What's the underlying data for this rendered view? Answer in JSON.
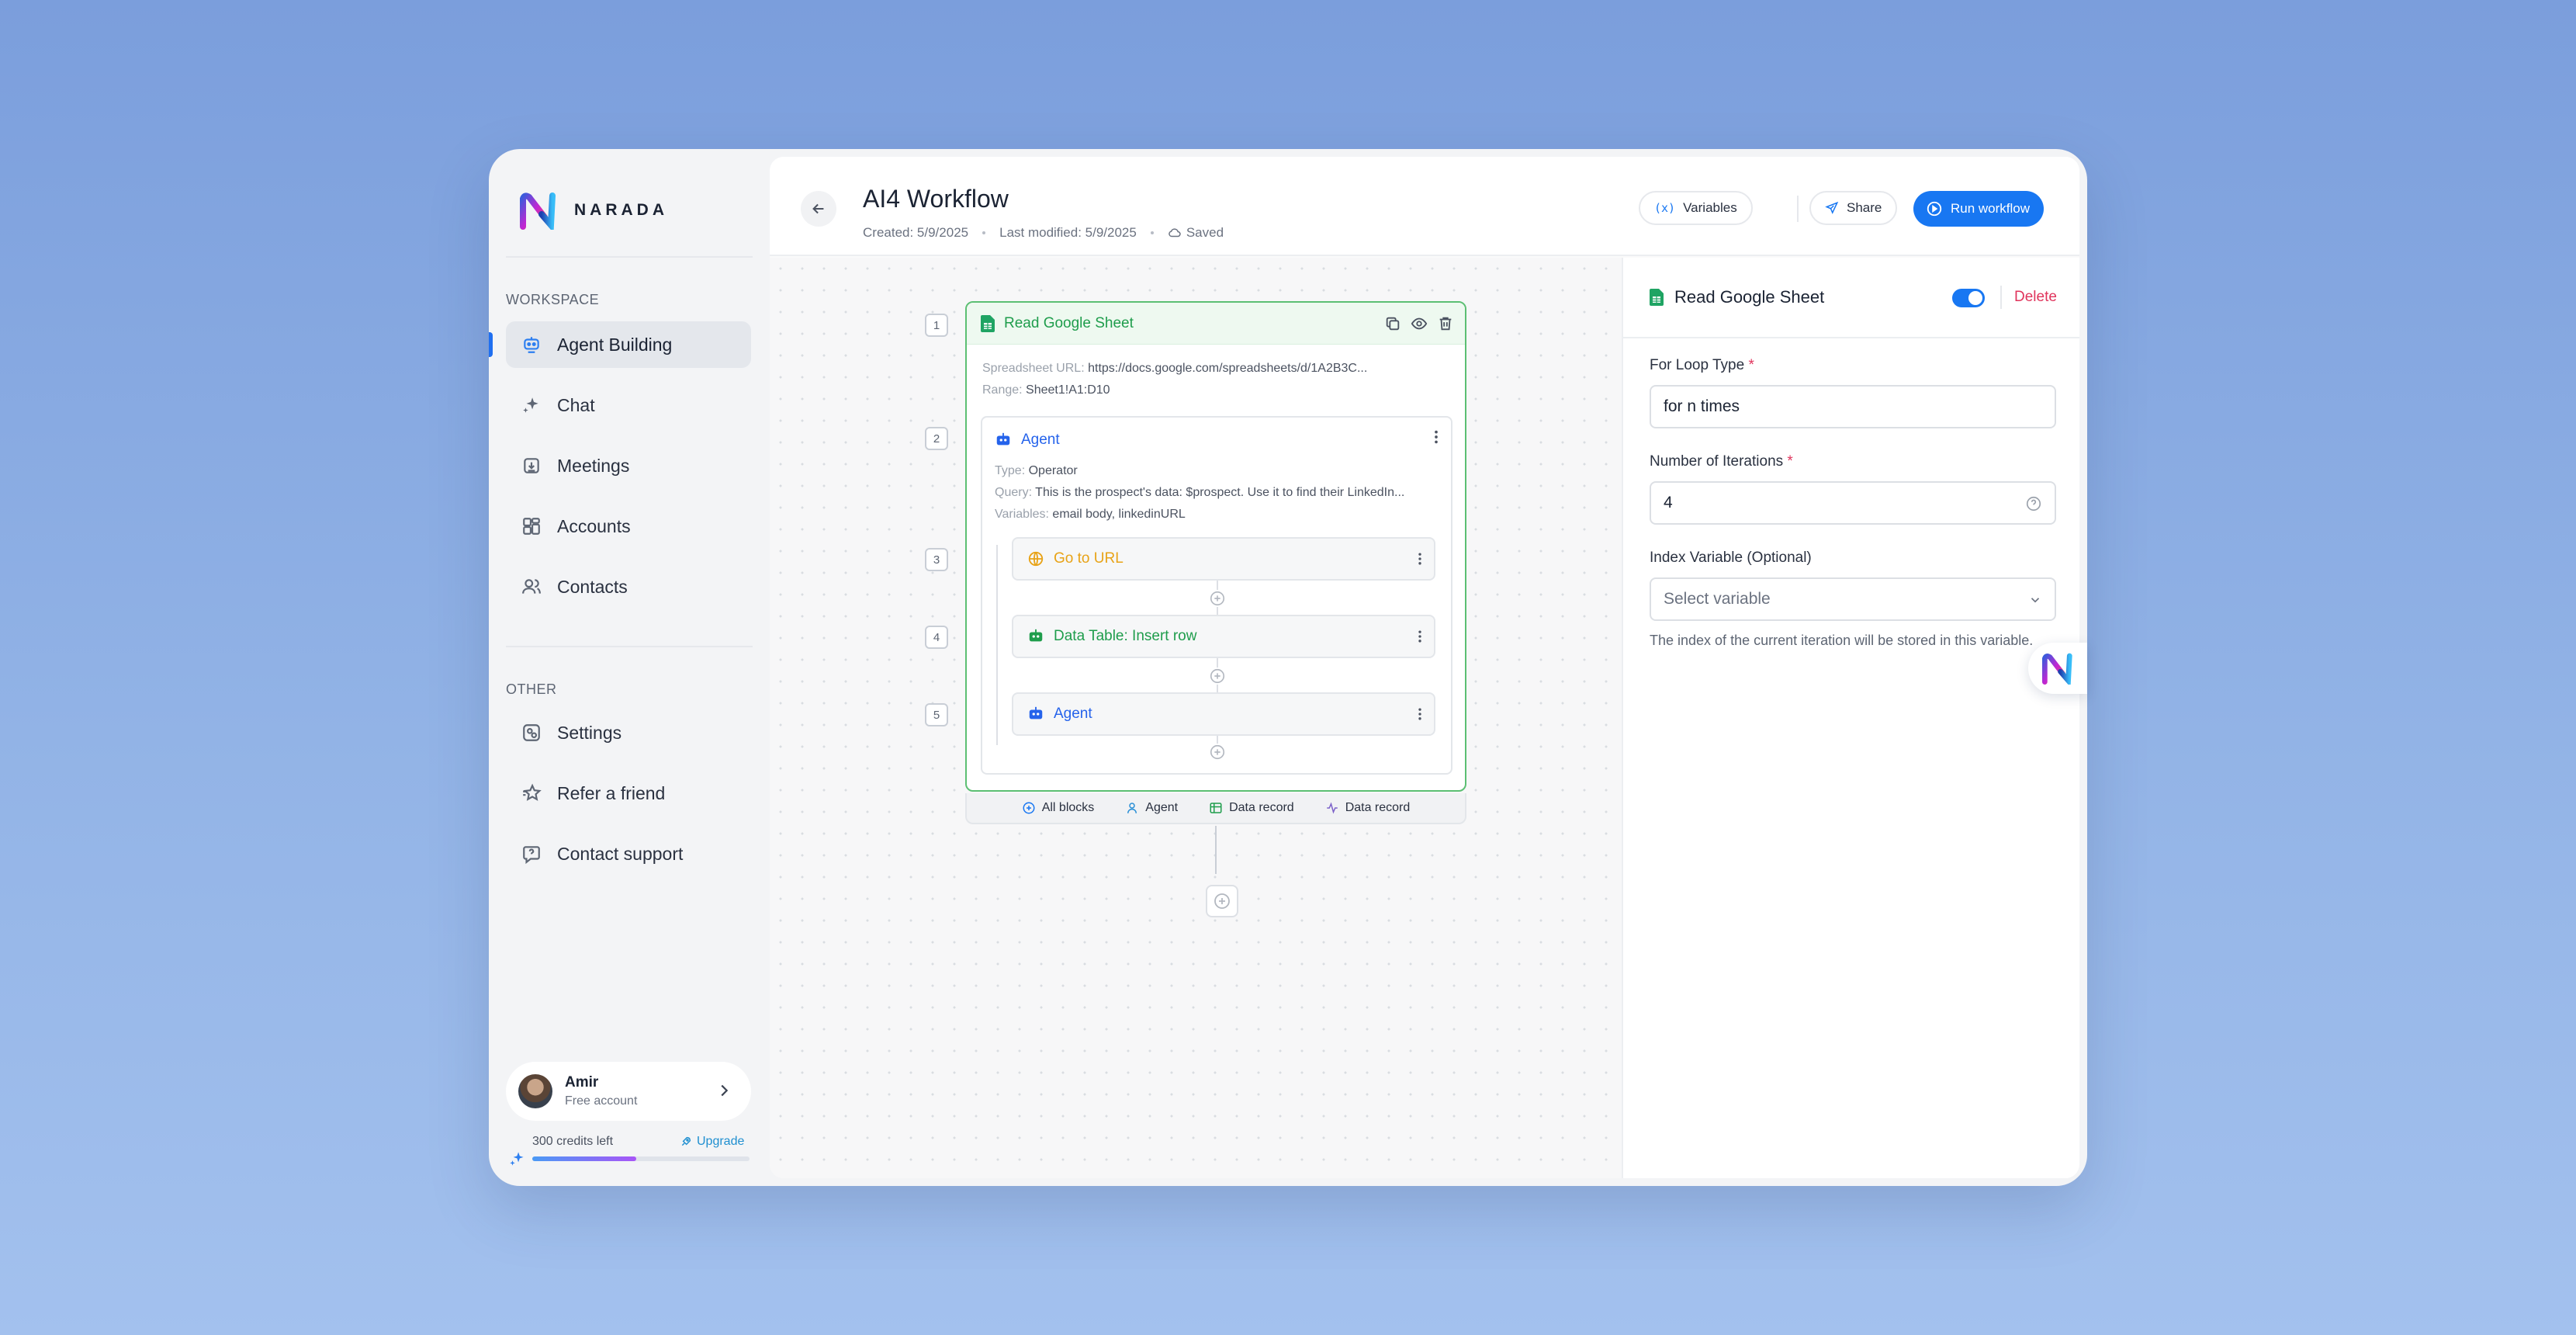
{
  "brand": {
    "name": "NARADA"
  },
  "sidebar": {
    "workspace_label": "WORKSPACE",
    "other_label": "OTHER",
    "items": [
      {
        "label": "Agent Building",
        "icon": "robot-icon",
        "active": true
      },
      {
        "label": "Chat",
        "icon": "sparkle-icon"
      },
      {
        "label": "Meetings",
        "icon": "calendar-download-icon"
      },
      {
        "label": "Accounts",
        "icon": "grid-icon"
      },
      {
        "label": "Contacts",
        "icon": "users-icon"
      }
    ],
    "other_items": [
      {
        "label": "Settings",
        "icon": "settings-icon"
      },
      {
        "label": "Refer a friend",
        "icon": "star-icon"
      },
      {
        "label": "Contact support",
        "icon": "help-bubble-icon"
      }
    ],
    "user": {
      "name": "Amir",
      "plan": "Free account"
    },
    "credits": {
      "text": "300 credits left",
      "upgrade_label": "Upgrade",
      "progress": 0.48
    }
  },
  "header": {
    "title": "AI4 Workflow",
    "created": "Created: 5/9/2025",
    "modified": "Last modified: 5/9/2025",
    "saved": "Saved",
    "variables_label": "Variables",
    "share_label": "Share",
    "run_label": "Run workflow"
  },
  "canvas": {
    "steps": [
      "1",
      "2",
      "3",
      "4",
      "5"
    ],
    "sheet_block": {
      "title": "Read Google Sheet",
      "url_key": "Spreadsheet URL:",
      "url_value": "https://docs.google.com/spreadsheets/d/1A2B3C...",
      "range_key": "Range:",
      "range_value": "Sheet1!A1:D10"
    },
    "agent_block": {
      "title": "Agent",
      "type_key": "Type:",
      "type_value": "Operator",
      "query_key": "Query:",
      "query_value": "This is the prospect's data: $prospect. Use it to find their LinkedIn...",
      "vars_key": "Variables:",
      "vars_value": "email body, linkedinURL"
    },
    "inner_blocks": [
      {
        "title": "Go to URL",
        "icon": "globe-icon",
        "color": "#e8a317"
      },
      {
        "title": "Data Table: Insert row",
        "icon": "robot-icon",
        "color": "#1f9d4c"
      },
      {
        "title": "Agent",
        "icon": "robot-icon",
        "color": "#2563eb"
      }
    ],
    "tray": [
      {
        "label": "All blocks",
        "icon": "plus-circle-icon"
      },
      {
        "label": "Agent",
        "icon": "robot-icon"
      },
      {
        "label": "Data record",
        "icon": "table-icon"
      },
      {
        "label": "Data record",
        "icon": "activity-icon"
      }
    ]
  },
  "panel": {
    "title": "Read Google Sheet",
    "toggle_on": true,
    "delete_label": "Delete",
    "loop_type_label": "For Loop Type",
    "loop_type_value": "for n times",
    "iterations_label": "Number of Iterations",
    "iterations_value": "4",
    "index_label": "Index Variable (Optional)",
    "index_placeholder": "Select variable",
    "help_text": "The index of the current iteration will be stored in this variable."
  },
  "colors": {
    "accent": "#1877f2",
    "success": "#1f9d4c",
    "warning": "#e8a317",
    "danger": "#e0345c"
  }
}
